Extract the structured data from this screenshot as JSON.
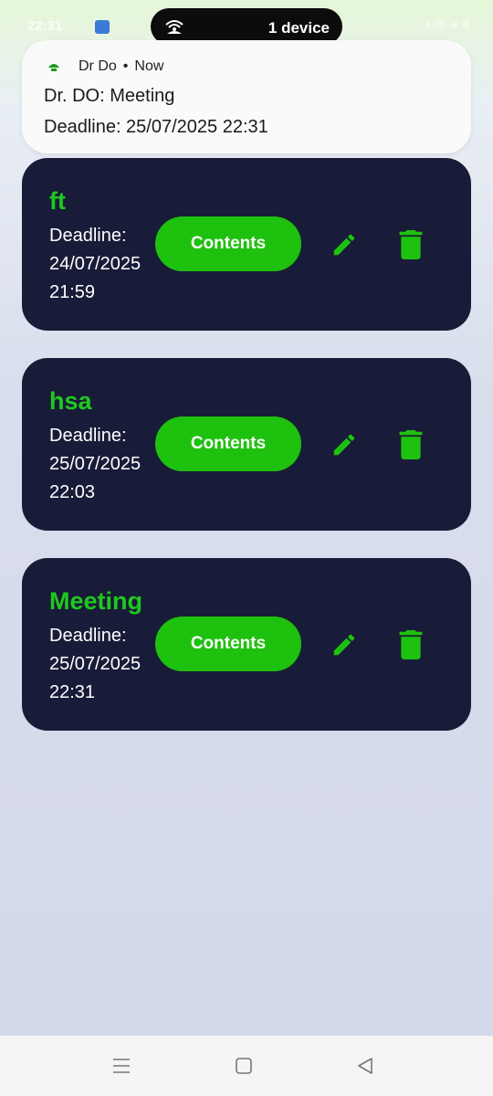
{
  "status_bar": {
    "time": "22:31",
    "pill_text": "1 device",
    "right_text": "4.00 ≋ ıll"
  },
  "notification": {
    "app_name": "Dr Do",
    "separator": "•",
    "time": "Now",
    "title": "Dr. DO: Meeting",
    "body": "Deadline: 25/07/2025 22:31"
  },
  "tasks": [
    {
      "title": "ft",
      "deadline_line1": "Deadline:",
      "deadline_line2": "24/07/2025",
      "deadline_line3": "21:59",
      "contents_label": "Contents"
    },
    {
      "title": "hsa",
      "deadline_line1": "Deadline:",
      "deadline_line2": "25/07/2025",
      "deadline_line3": "22:03",
      "contents_label": "Contents"
    },
    {
      "title": "Meeting",
      "deadline_line1": "Deadline:",
      "deadline_line2": "25/07/2025",
      "deadline_line3": "22:31",
      "contents_label": "Contents"
    }
  ],
  "colors": {
    "card_background": "#181c38",
    "accent_green": "#1ec10e",
    "title_green": "#1ec91e"
  },
  "icons": {
    "edit": "pencil-icon",
    "delete": "trash-icon",
    "nav_menu": "menu-icon",
    "nav_home": "home-square-icon",
    "nav_back": "back-triangle-icon"
  }
}
